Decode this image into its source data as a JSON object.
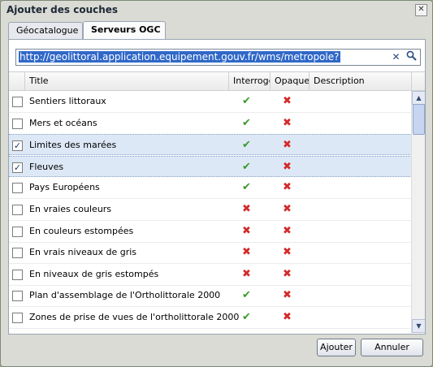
{
  "window": {
    "title": "Ajouter des couches",
    "close_glyph": "✕"
  },
  "tabs": [
    {
      "label": "Géocatalogue",
      "active": false
    },
    {
      "label": "Serveurs OGC",
      "active": true
    }
  ],
  "url": {
    "value": "http://geolittoral.application.equipement.gouv.fr/wms/metropole?",
    "clear_icon": "clear-icon",
    "search_icon": "search-icon"
  },
  "table": {
    "columns": [
      "Title",
      "Interroge",
      "Opaque",
      "Description"
    ],
    "rows": [
      {
        "title": "Sentiers littoraux",
        "checked": false,
        "interroge": true,
        "opaque": false
      },
      {
        "title": "Mers et océans",
        "checked": false,
        "interroge": true,
        "opaque": false
      },
      {
        "title": "Limites des marées",
        "checked": true,
        "interroge": true,
        "opaque": false
      },
      {
        "title": "Fleuves",
        "checked": true,
        "interroge": true,
        "opaque": false
      },
      {
        "title": "Pays Européens",
        "checked": false,
        "interroge": true,
        "opaque": false
      },
      {
        "title": "En vraies couleurs",
        "checked": false,
        "interroge": false,
        "opaque": false
      },
      {
        "title": "En couleurs estompées",
        "checked": false,
        "interroge": false,
        "opaque": false
      },
      {
        "title": "En vrais niveaux de gris",
        "checked": false,
        "interroge": false,
        "opaque": false
      },
      {
        "title": "En niveaux de gris estompés",
        "checked": false,
        "interroge": false,
        "opaque": false
      },
      {
        "title": "Plan d'assemblage de l'Ortholittorale 2000",
        "checked": false,
        "interroge": true,
        "opaque": false
      },
      {
        "title": "Zones de prise de vues de l'ortholittorale 2000",
        "checked": false,
        "interroge": true,
        "opaque": false
      }
    ]
  },
  "buttons": {
    "add": "Ajouter",
    "cancel": "Annuler"
  },
  "colors": {
    "check": "#3a9a2a",
    "cross": "#d42a2a",
    "selection": "#dde8f6"
  }
}
